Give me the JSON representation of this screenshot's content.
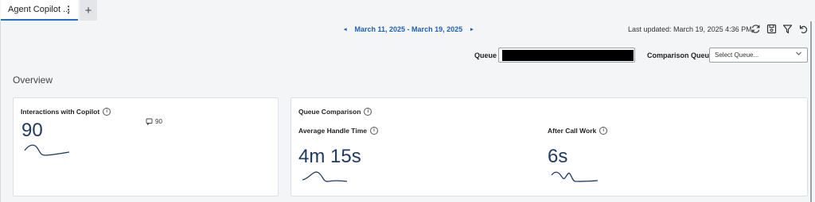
{
  "tabs": {
    "active_label": "Agent Copilot ...",
    "menu_glyph": "⋮",
    "add_glyph": "+"
  },
  "date_range": {
    "label": "March 11, 2025 - March 19, 2025",
    "prev": "◂",
    "next": "▸"
  },
  "last_updated": "Last updated: March 19, 2025 4:36 PM",
  "toolbar": {
    "icons": [
      "refresh-icon",
      "save-icon",
      "filter-icon",
      "undo-icon"
    ]
  },
  "filters": {
    "queue_label": "Queue",
    "comparison_label": "Comparison Queue",
    "comparison_placeholder": "Select Queue..."
  },
  "overview_heading": "Overview",
  "card_interactions": {
    "title": "Interactions with Copilot",
    "value": "90",
    "chat_count": "90"
  },
  "card_queue": {
    "title": "Queue Comparison",
    "aht_title": "Average Handle Time",
    "aht_value": "4m 15s",
    "acw_title": "After Call Work",
    "acw_value": "6s"
  },
  "colors": {
    "accent": "#1f6fd1",
    "metric": "#1f3b64",
    "link": "#1f5fb8"
  }
}
